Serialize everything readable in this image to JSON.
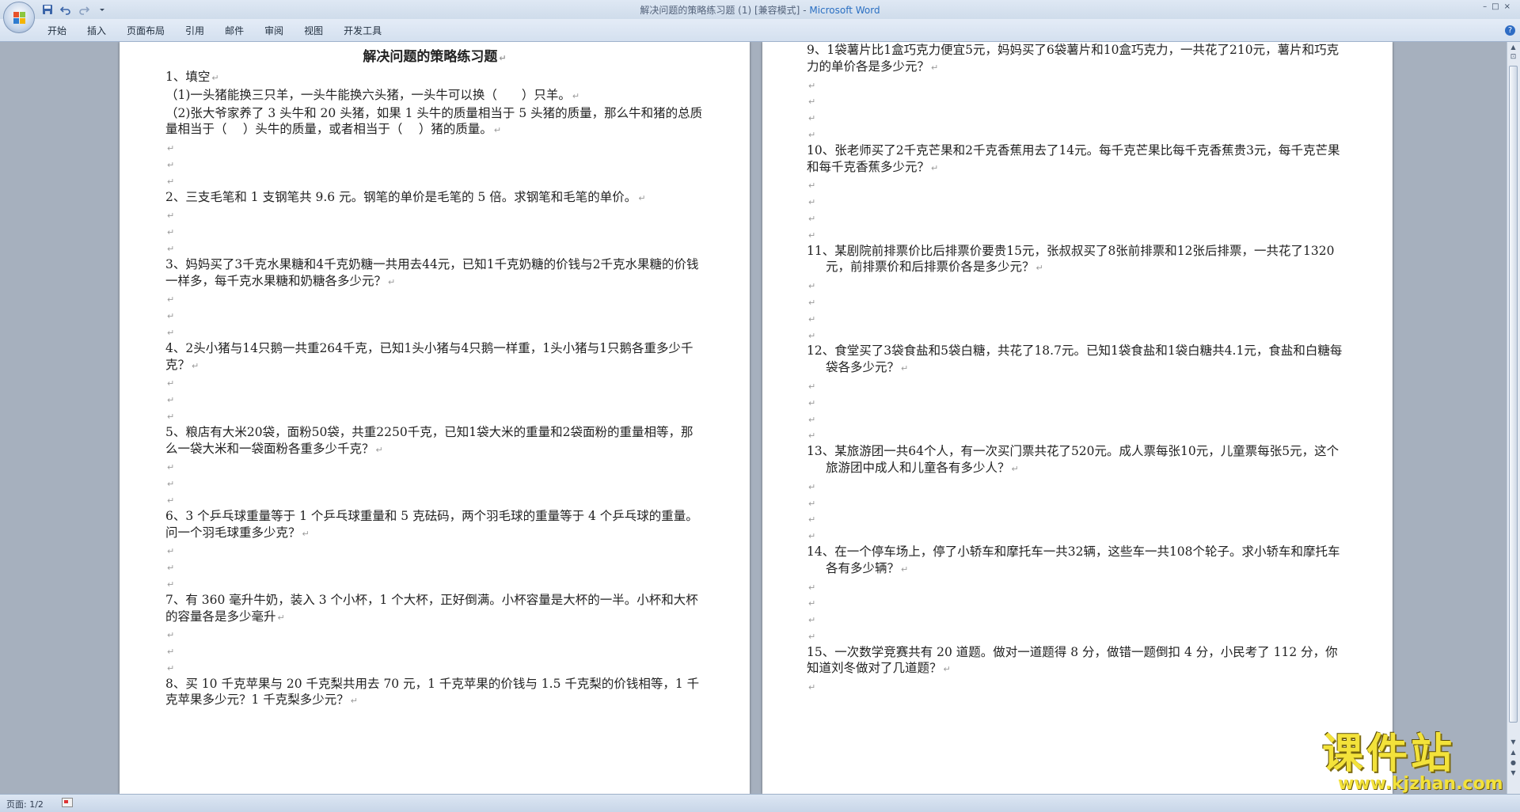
{
  "window": {
    "title": "解决问题的策略练习题 (1) [兼容模式]",
    "app_name": "Microsoft Word",
    "controls": [
      "–",
      "□",
      "×"
    ]
  },
  "ribbon": {
    "tabs": [
      "开始",
      "插入",
      "页面布局",
      "引用",
      "邮件",
      "审阅",
      "视图",
      "开发工具"
    ]
  },
  "quick_access": [
    "save-icon",
    "undo-icon",
    "redo-icon",
    "customize-icon"
  ],
  "document": {
    "title": "解决问题的策略练习题",
    "left_paragraphs": [
      {
        "t": "1、填空"
      },
      {
        "t": "（1)一头猪能换三只羊，一头牛能换六头猪，一头牛可以换（　　）只羊。"
      },
      {
        "t": "（2)张大爷家养了 3 头牛和 20 头猪，如果 1 头牛的质量相当于 5 头猪的质量，那么牛和猪的总质量相当于（　 ）头牛的质量，或者相当于（　 ）猪的质量。"
      },
      {
        "t": ""
      },
      {
        "t": ""
      },
      {
        "t": ""
      },
      {
        "t": "2、三支毛笔和 1 支钢笔共 9.6 元。钢笔的单价是毛笔的 5 倍。求钢笔和毛笔的单价。"
      },
      {
        "t": ""
      },
      {
        "t": ""
      },
      {
        "t": ""
      },
      {
        "t": "3、妈妈买了3千克水果糖和4千克奶糖一共用去44元，已知1千克奶糖的价钱与2千克水果糖的价钱一样多，每千克水果糖和奶糖各多少元？"
      },
      {
        "t": ""
      },
      {
        "t": ""
      },
      {
        "t": ""
      },
      {
        "t": "4、2头小猪与14只鹅一共重264千克，已知1头小猪与4只鹅一样重，1头小猪与1只鹅各重多少千克？"
      },
      {
        "t": ""
      },
      {
        "t": ""
      },
      {
        "t": ""
      },
      {
        "t": "5、粮店有大米20袋，面粉50袋，共重2250千克，已知1袋大米的重量和2袋面粉的重量相等，那么一袋大米和一袋面粉各重多少千克？"
      },
      {
        "t": ""
      },
      {
        "t": ""
      },
      {
        "t": ""
      },
      {
        "t": "6、3 个乒乓球重量等于 1 个乒乓球重量和 5 克砝码，两个羽毛球的重量等于 4 个乒乓球的重量。问一个羽毛球重多少克？"
      },
      {
        "t": ""
      },
      {
        "t": ""
      },
      {
        "t": ""
      },
      {
        "t": "7、有 360 毫升牛奶，装入 3 个小杯，1 个大杯，正好倒满。小杯容量是大杯的一半。小杯和大杯的容量各是多少毫升"
      },
      {
        "t": ""
      },
      {
        "t": ""
      },
      {
        "t": ""
      },
      {
        "t": "8、买 10 千克苹果与 20 千克梨共用去 70 元，1 千克苹果的价钱与 1.5 千克梨的价钱相等，1 千克苹果多少元？1 千克梨多少元？"
      }
    ],
    "right_paragraphs": [
      {
        "t": "9、1袋薯片比1盒巧克力便宜5元，妈妈买了6袋薯片和10盒巧克力，一共花了210元，薯片和巧克力的单价各是多少元？"
      },
      {
        "t": ""
      },
      {
        "t": ""
      },
      {
        "t": ""
      },
      {
        "t": ""
      },
      {
        "t": "10、张老师买了2千克芒果和2千克香蕉用去了14元。每千克芒果比每千克香蕉贵3元，每千克芒果和每千克香蕉多少元？"
      },
      {
        "t": ""
      },
      {
        "t": ""
      },
      {
        "t": ""
      },
      {
        "t": ""
      },
      {
        "t": "11、某剧院前排票价比后排票价要贵15元，张叔叔买了8张前排票和12张后排票，一共花了1320元，前排票价和后排票价各是多少元？",
        "hang": true
      },
      {
        "t": ""
      },
      {
        "t": ""
      },
      {
        "t": ""
      },
      {
        "t": ""
      },
      {
        "t": "12、食堂买了3袋食盐和5袋白糖，共花了18.7元。已知1袋食盐和1袋白糖共4.1元，食盐和白糖每袋各多少元？",
        "hang": true
      },
      {
        "t": ""
      },
      {
        "t": ""
      },
      {
        "t": ""
      },
      {
        "t": ""
      },
      {
        "t": "13、某旅游团一共64个人，有一次买门票共花了520元。成人票每张10元，儿童票每张5元，这个旅游团中成人和儿童各有多少人？",
        "hang": true
      },
      {
        "t": ""
      },
      {
        "t": ""
      },
      {
        "t": ""
      },
      {
        "t": ""
      },
      {
        "t": "14、在一个停车场上，停了小轿车和摩托车一共32辆，这些车一共108个轮子。求小轿车和摩托车各有多少辆？",
        "hang": true
      },
      {
        "t": ""
      },
      {
        "t": ""
      },
      {
        "t": ""
      },
      {
        "t": ""
      },
      {
        "t": "15、一次数学竞赛共有 20 道题。做对一道题得 8 分，做错一题倒扣 4 分，小民考了 112 分，你知道刘冬做对了几道题？"
      },
      {
        "t": ""
      }
    ],
    "paragraph_mark": "↵"
  },
  "status": {
    "page": "页面: 1/2"
  },
  "watermark": {
    "text": "课件站",
    "url": "www.kjzhan.com"
  },
  "colors": {
    "title_blue": "#2a6fc2",
    "watermark_yellow": "#f3e23a"
  }
}
